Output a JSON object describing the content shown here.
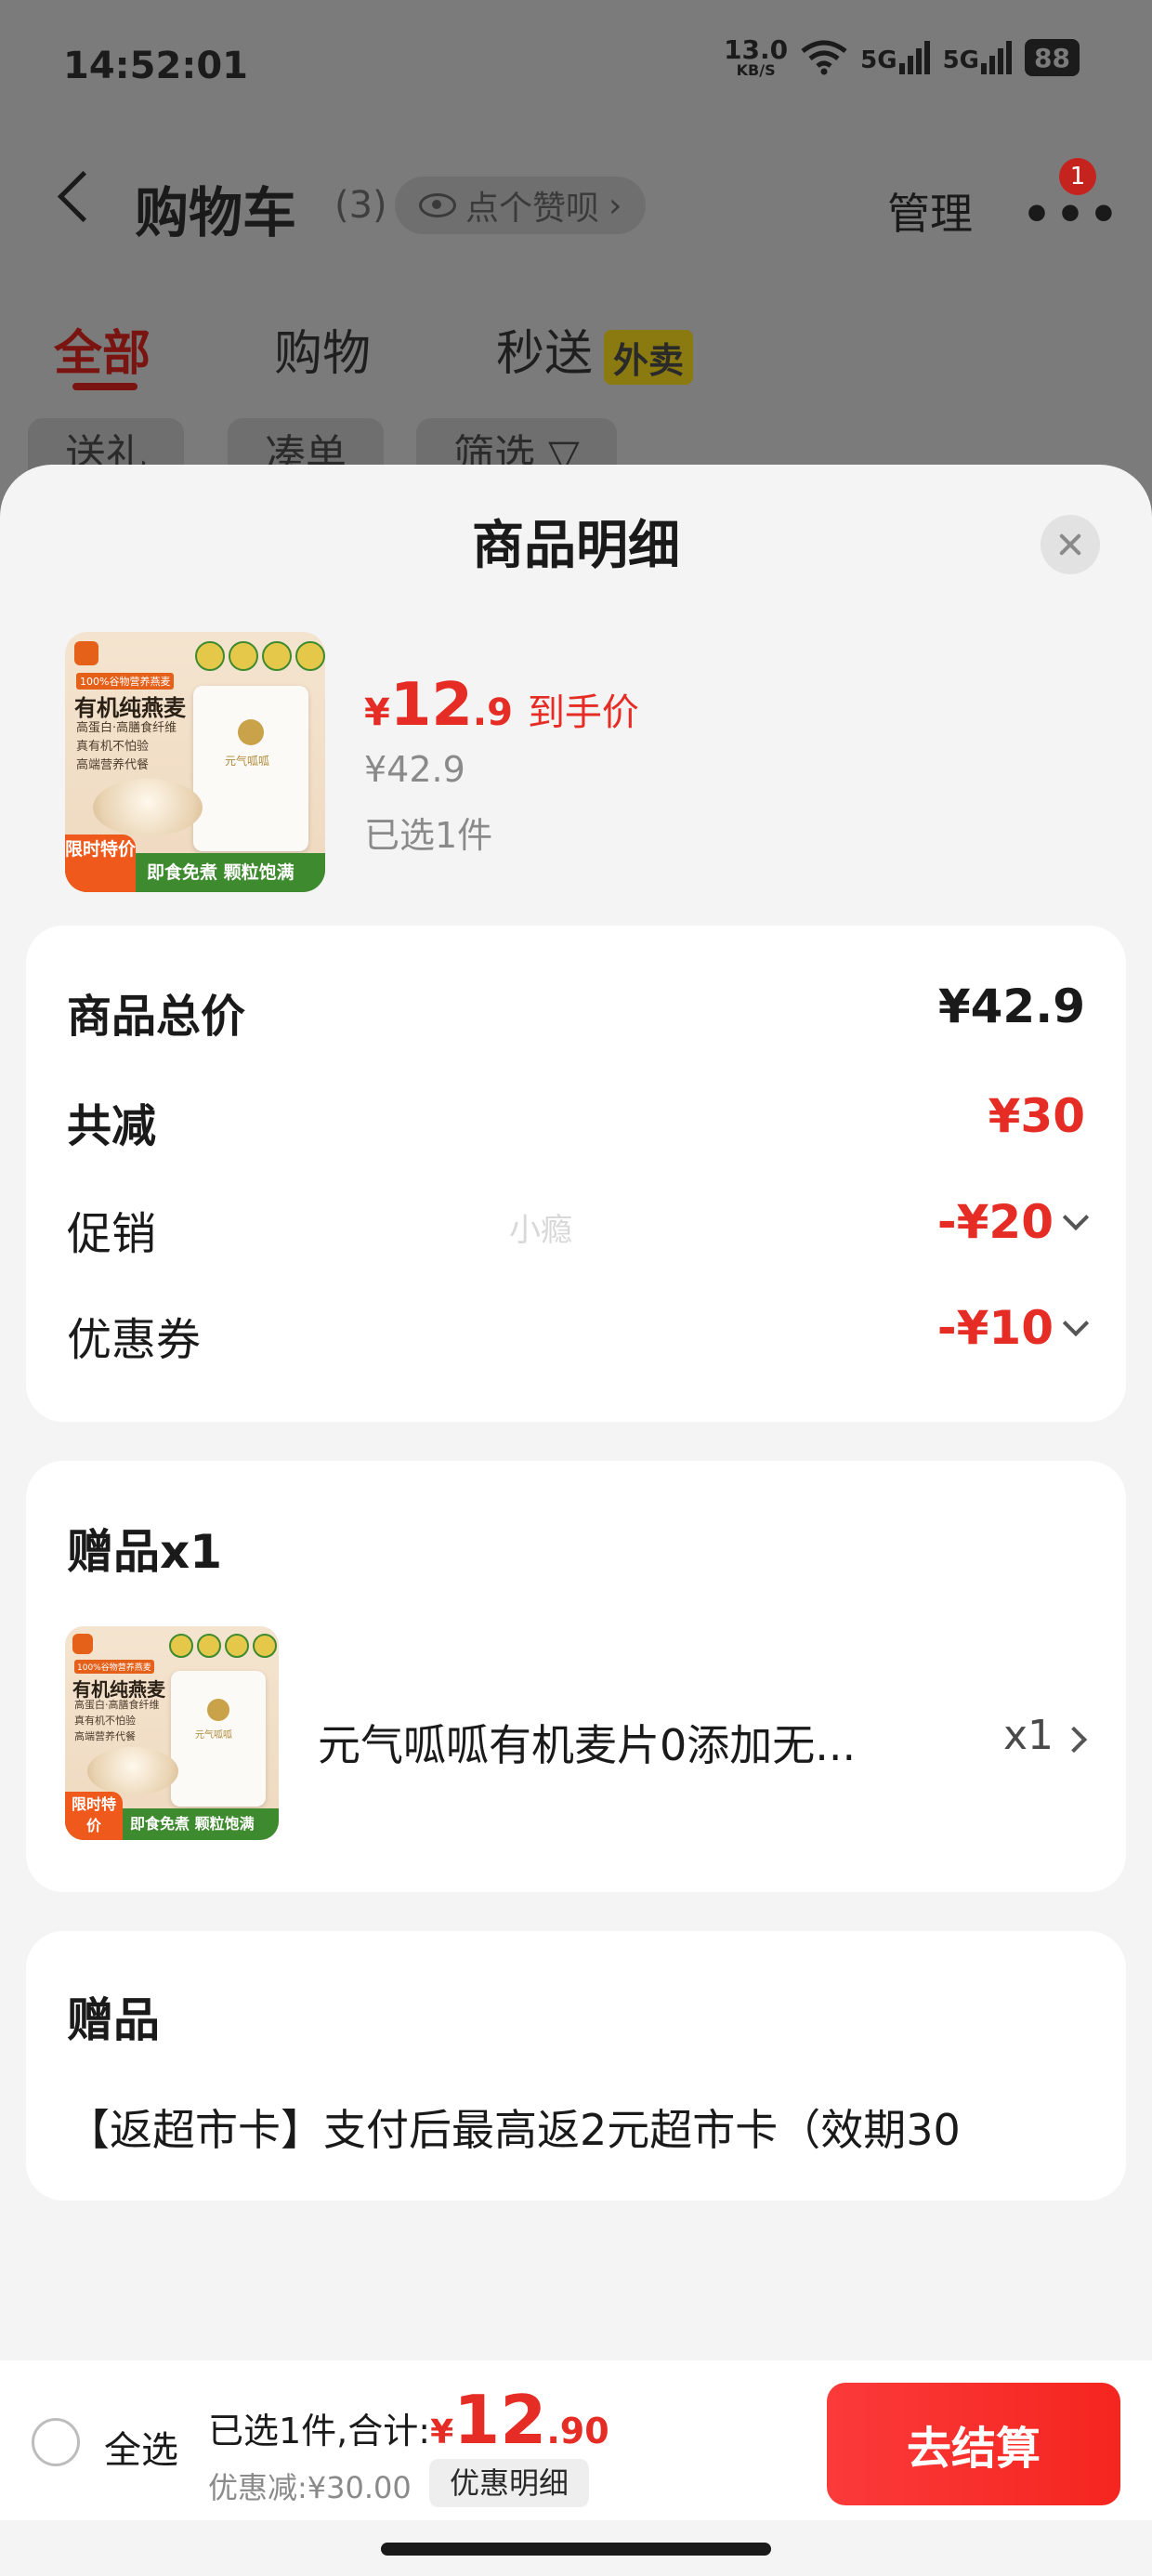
{
  "status_bar": {
    "time": "14:52:01",
    "net_speed_value": "13.0",
    "net_speed_unit": "KB/S",
    "signal1": "5G",
    "signal2": "5G",
    "battery": "88"
  },
  "cart_header": {
    "title": "购物车",
    "count": "(3)",
    "like_label": "点个赞呗",
    "manage_label": "管理",
    "more_badge": "1"
  },
  "cart_tabs": [
    {
      "label": "全部"
    },
    {
      "label": "购物"
    },
    {
      "label": "秒送",
      "tag": "外卖"
    }
  ],
  "filter_chips": [
    {
      "label": "送礼"
    },
    {
      "label": "凑单"
    },
    {
      "label": "筛选 ▽"
    }
  ],
  "sheet": {
    "title": "商品明细",
    "product": {
      "price_symbol": "¥",
      "price_integer": "12",
      "price_decimal": ".9",
      "price_label": "到手价",
      "original_price": "¥42.9",
      "selected_count": "已选1件",
      "thumb": {
        "badge": "100%谷物营养燕麦",
        "title": "有机纯燕麦",
        "sub1": "高蛋白·高膳食纤维",
        "sub2": "真有机不怕验",
        "sub3": "高端营养代餐",
        "bag_brand": "元气呱呱",
        "strip": "即食免煮 颗粒饱满",
        "flash": "限时特价"
      }
    },
    "summary": {
      "total_label": "商品总价",
      "total_value": "¥42.9",
      "reduce_label": "共减",
      "reduce_value": "¥30",
      "promo_label": "促销",
      "promo_value": "-¥20",
      "coupon_label": "优惠券",
      "coupon_value": "-¥10",
      "watermark": "小瘾"
    },
    "gift_card": {
      "title": "赠品x1",
      "item_name": "元气呱呱有机麦片0添加无...",
      "item_qty": "x1"
    },
    "gift_card2": {
      "title": "赠品",
      "description": "【返超市卡】支付后最高返2元超市卡（效期30"
    }
  },
  "checkout": {
    "select_all_label": "全选",
    "summary_text": "已选1件,合计:",
    "total_symbol": "¥",
    "total_integer": "12",
    "total_decimal": ".90",
    "discount_text": "优惠减:¥30.00",
    "discount_detail_label": "优惠明细",
    "checkout_label": "去结算"
  },
  "colors": {
    "accent_red": "#e52d25",
    "checkout_button": "#f5251f",
    "overlay_background": "#7b7b7b"
  }
}
